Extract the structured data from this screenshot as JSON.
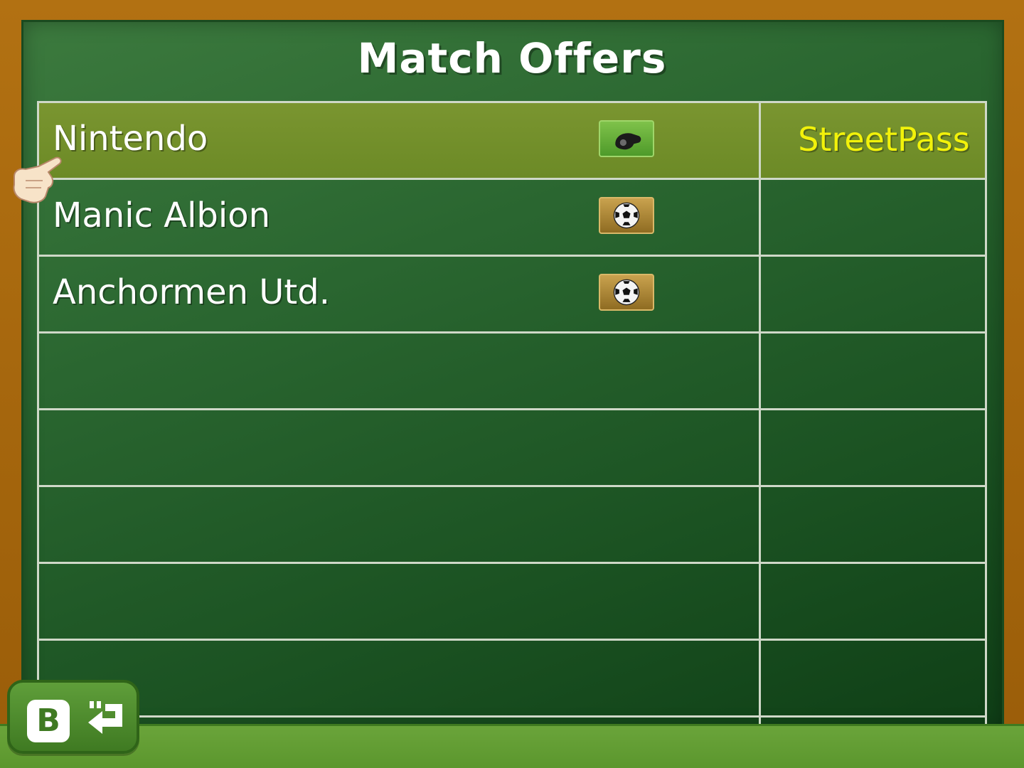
{
  "screen": {
    "title": "Match Offers"
  },
  "offers": [
    {
      "name": "Nintendo",
      "icon": "whistle-icon",
      "tag": "StreetPass",
      "selected": true
    },
    {
      "name": "Manic Albion",
      "icon": "soccer-ball-icon",
      "tag": "",
      "selected": false
    },
    {
      "name": "Anchormen Utd.",
      "icon": "soccer-ball-icon",
      "tag": "",
      "selected": false
    }
  ],
  "controls": {
    "back_button_key": "B",
    "back_icon": "return-arrow-icon"
  },
  "colors": {
    "board_green": "#2a6630",
    "frame_wood": "#a4650a",
    "selected_row": "#6c8a26",
    "tag_yellow": "#f2f20a",
    "ground_green": "#5b962d"
  }
}
